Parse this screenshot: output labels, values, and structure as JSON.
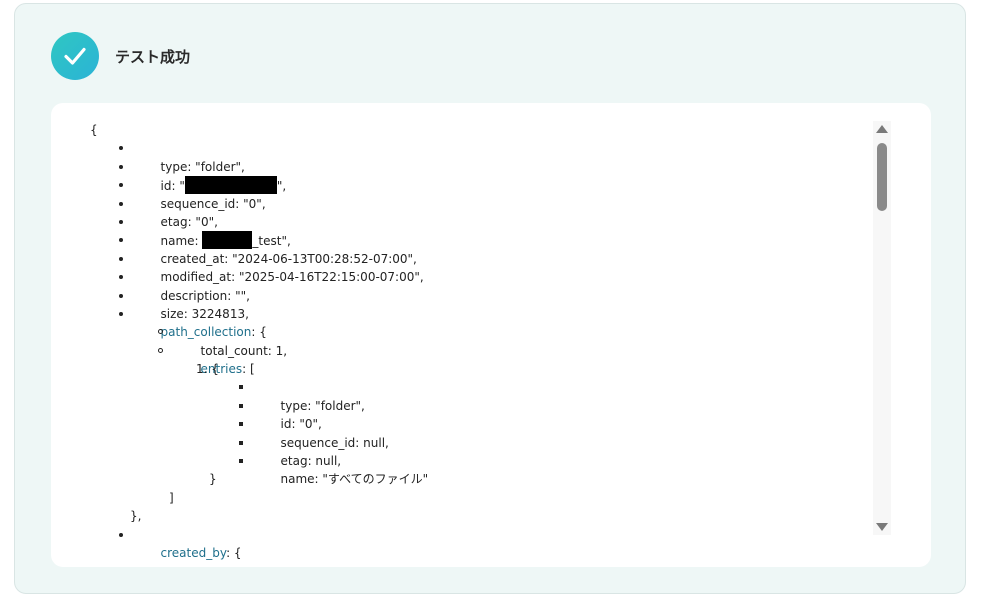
{
  "header": {
    "title": "テスト成功"
  },
  "json_view": {
    "open_brace": "{",
    "lines": {
      "type": "type: \"folder\",",
      "id_prefix": "id: \"",
      "id_suffix": "\",",
      "sequence_id": "sequence_id: \"0\",",
      "etag": "etag: \"0\",",
      "name_prefix": "name: ",
      "name_suffix": "_test\",",
      "created_at": "created_at: \"2024-06-13T00:28:52-07:00\",",
      "modified_at": "modified_at: \"2025-04-16T22:15:00-07:00\",",
      "description": "description: \"\",",
      "size": "size: 3224813,",
      "path_collection_key": "path_collection",
      "path_collection_rest": ": {",
      "total_count": "total_count: 1,",
      "entries_key": "entries",
      "entries_rest": ": [",
      "entry_num": "1. {",
      "e_type": "type: \"folder\",",
      "e_id": "id: \"0\",",
      "e_sequence_id": "sequence_id: null,",
      "e_etag": "etag: null,",
      "e_name": "name: \"すべてのファイル\"",
      "close_brace": "}",
      "close_bracket": "]",
      "close_obj": "},",
      "created_by_key": "created_by",
      "created_by_rest": ": {"
    }
  }
}
